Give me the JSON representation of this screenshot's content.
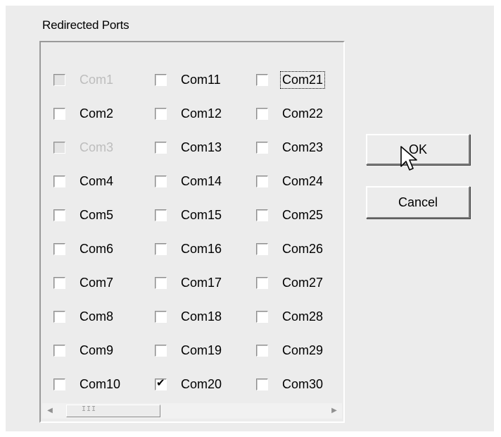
{
  "group": {
    "title": "Redirected Ports"
  },
  "ports": [
    {
      "label": "Com1",
      "checked": false,
      "disabled": true,
      "focused": false
    },
    {
      "label": "Com2",
      "checked": false,
      "disabled": false,
      "focused": false
    },
    {
      "label": "Com3",
      "checked": false,
      "disabled": true,
      "focused": false
    },
    {
      "label": "Com4",
      "checked": false,
      "disabled": false,
      "focused": false
    },
    {
      "label": "Com5",
      "checked": false,
      "disabled": false,
      "focused": false
    },
    {
      "label": "Com6",
      "checked": false,
      "disabled": false,
      "focused": false
    },
    {
      "label": "Com7",
      "checked": false,
      "disabled": false,
      "focused": false
    },
    {
      "label": "Com8",
      "checked": false,
      "disabled": false,
      "focused": false
    },
    {
      "label": "Com9",
      "checked": false,
      "disabled": false,
      "focused": false
    },
    {
      "label": "Com10",
      "checked": false,
      "disabled": false,
      "focused": false
    },
    {
      "label": "Com11",
      "checked": false,
      "disabled": false,
      "focused": false
    },
    {
      "label": "Com12",
      "checked": false,
      "disabled": false,
      "focused": false
    },
    {
      "label": "Com13",
      "checked": false,
      "disabled": false,
      "focused": false
    },
    {
      "label": "Com14",
      "checked": false,
      "disabled": false,
      "focused": false
    },
    {
      "label": "Com15",
      "checked": false,
      "disabled": false,
      "focused": false
    },
    {
      "label": "Com16",
      "checked": false,
      "disabled": false,
      "focused": false
    },
    {
      "label": "Com17",
      "checked": false,
      "disabled": false,
      "focused": false
    },
    {
      "label": "Com18",
      "checked": false,
      "disabled": false,
      "focused": false
    },
    {
      "label": "Com19",
      "checked": false,
      "disabled": false,
      "focused": false
    },
    {
      "label": "Com20",
      "checked": true,
      "disabled": false,
      "focused": false
    },
    {
      "label": "Com21",
      "checked": false,
      "disabled": false,
      "focused": true
    },
    {
      "label": "Com22",
      "checked": false,
      "disabled": false,
      "focused": false
    },
    {
      "label": "Com23",
      "checked": false,
      "disabled": false,
      "focused": false
    },
    {
      "label": "Com24",
      "checked": false,
      "disabled": false,
      "focused": false
    },
    {
      "label": "Com25",
      "checked": false,
      "disabled": false,
      "focused": false
    },
    {
      "label": "Com26",
      "checked": false,
      "disabled": false,
      "focused": false
    },
    {
      "label": "Com27",
      "checked": false,
      "disabled": false,
      "focused": false
    },
    {
      "label": "Com28",
      "checked": false,
      "disabled": false,
      "focused": false
    },
    {
      "label": "Com29",
      "checked": false,
      "disabled": false,
      "focused": false
    },
    {
      "label": "Com30",
      "checked": false,
      "disabled": false,
      "focused": false
    }
  ],
  "scrollbar": {
    "left_icon": "scroll-left-arrow-icon",
    "right_icon": "scroll-right-arrow-icon",
    "grip": "III"
  },
  "buttons": {
    "ok_label": "OK",
    "cancel_label": "Cancel"
  },
  "cursor": {
    "icon": "arrow-cursor-icon"
  }
}
